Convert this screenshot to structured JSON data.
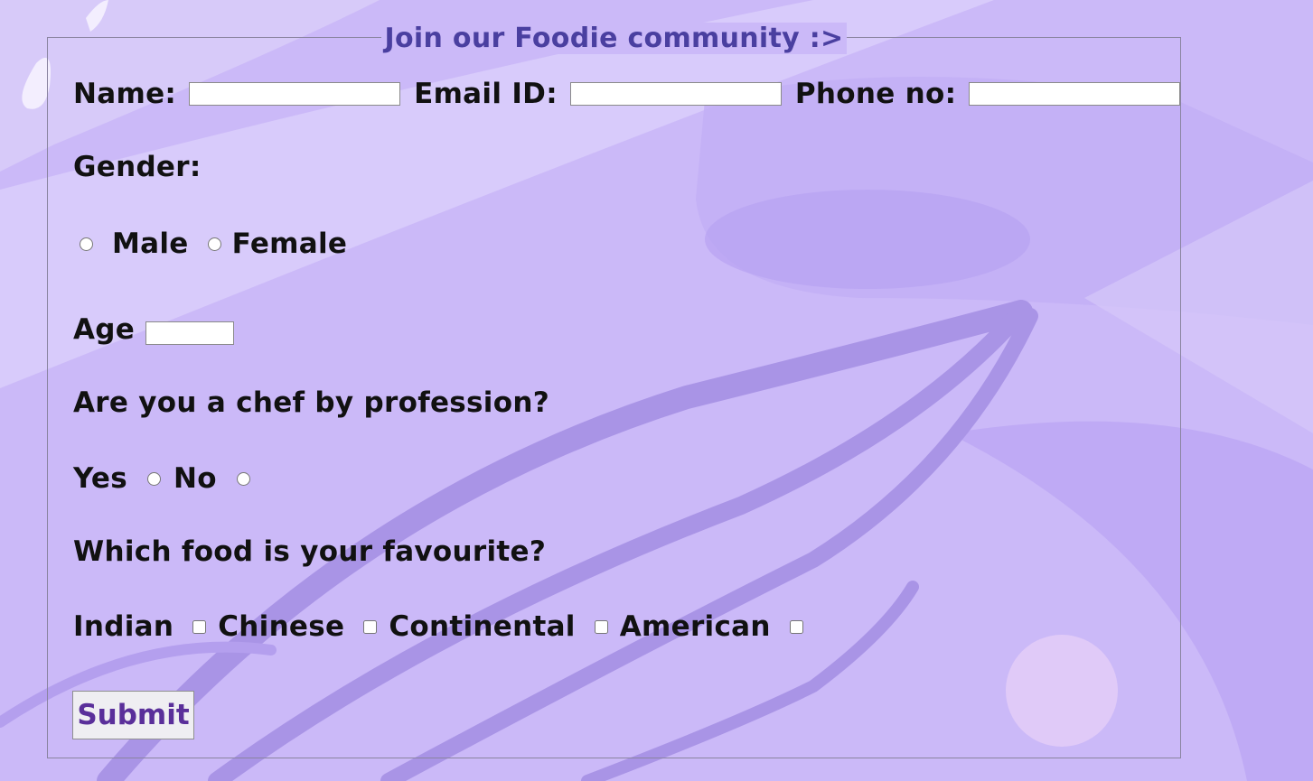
{
  "legend": "Join our Foodie community :>",
  "contact": {
    "name_label": "Name:",
    "name_value": "",
    "email_label": "Email ID:",
    "email_value": "",
    "phone_label": "Phone no:",
    "phone_value": ""
  },
  "gender": {
    "label": "Gender:",
    "options": [
      "Male",
      "Female"
    ]
  },
  "age": {
    "label": "Age",
    "value": ""
  },
  "chef": {
    "question": "Are you a chef by profession?",
    "yes_label": "Yes",
    "no_label": "No"
  },
  "food": {
    "question": "Which food is your favourite?",
    "options": [
      "Indian",
      "Chinese",
      "Continental",
      "American"
    ]
  },
  "submit_label": "Submit",
  "colors": {
    "background": "#cbb9f8",
    "legend_text": "#4a3fa0",
    "submit_text": "#5a2f9a"
  }
}
